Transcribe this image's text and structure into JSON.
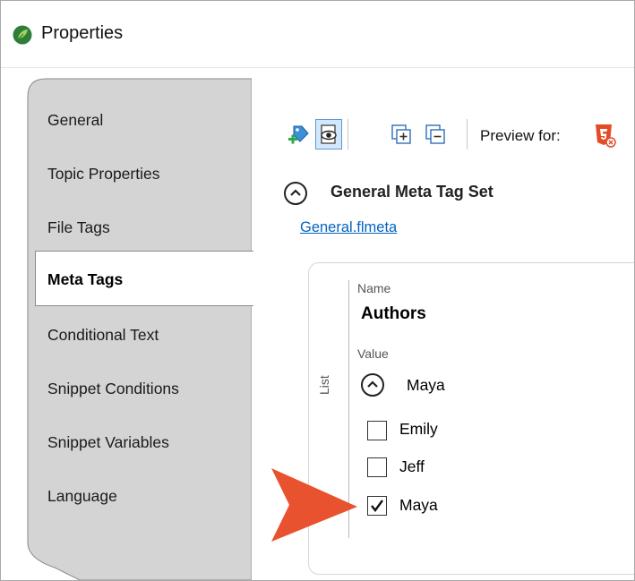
{
  "window": {
    "title": "Properties"
  },
  "tabs": [
    {
      "label": "General",
      "active": false
    },
    {
      "label": "Topic Properties",
      "active": false
    },
    {
      "label": "File Tags",
      "active": false
    },
    {
      "label": "Meta Tags",
      "active": true
    },
    {
      "label": "Conditional Text",
      "active": false
    },
    {
      "label": "Snippet Conditions",
      "active": false
    },
    {
      "label": "Snippet Variables",
      "active": false
    },
    {
      "label": "Language",
      "active": false
    }
  ],
  "toolbar": {
    "icons": [
      "tag-add-icon",
      "preview-eye-icon",
      "expand-all-icon",
      "collapse-all-icon",
      "html5-icon"
    ],
    "preview_label": "Preview for:"
  },
  "meta": {
    "section_title": "General Meta Tag Set",
    "link": "General.flmeta",
    "group_label": "List",
    "name_label": "Name",
    "name_value": "Authors",
    "value_label": "Value",
    "selected_value": "Maya",
    "options": [
      {
        "label": "Emily",
        "checked": false
      },
      {
        "label": "Jeff",
        "checked": false
      },
      {
        "label": "Maya",
        "checked": true
      }
    ]
  },
  "colors": {
    "arrow": "#e8522e",
    "tab_panel": "#d4d4d4",
    "link": "#0563c1",
    "selected_button": "#d4e8fb"
  }
}
